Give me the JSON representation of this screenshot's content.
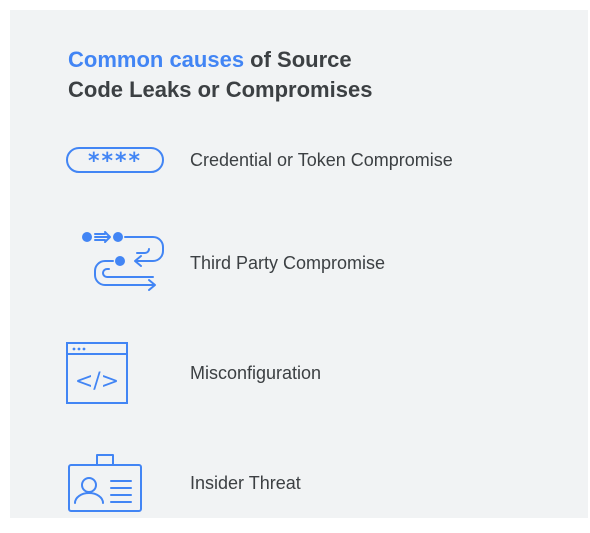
{
  "title": {
    "highlight": "Common causes",
    "rest_line1": " of Source",
    "line2": "Code Leaks or Compromises"
  },
  "items": [
    {
      "label": "Credential or Token Compromise",
      "icon": "password-asterisks-icon"
    },
    {
      "label": "Third Party Compromise",
      "icon": "data-flow-arrows-icon"
    },
    {
      "label": "Misconfiguration",
      "icon": "code-window-icon"
    },
    {
      "label": "Insider Threat",
      "icon": "id-badge-icon"
    }
  ],
  "icon_glyphs": {
    "password": "****",
    "code": "</>"
  },
  "colors": {
    "accent": "#4285f4",
    "text": "#3c4043",
    "background": "#f1f3f4"
  }
}
